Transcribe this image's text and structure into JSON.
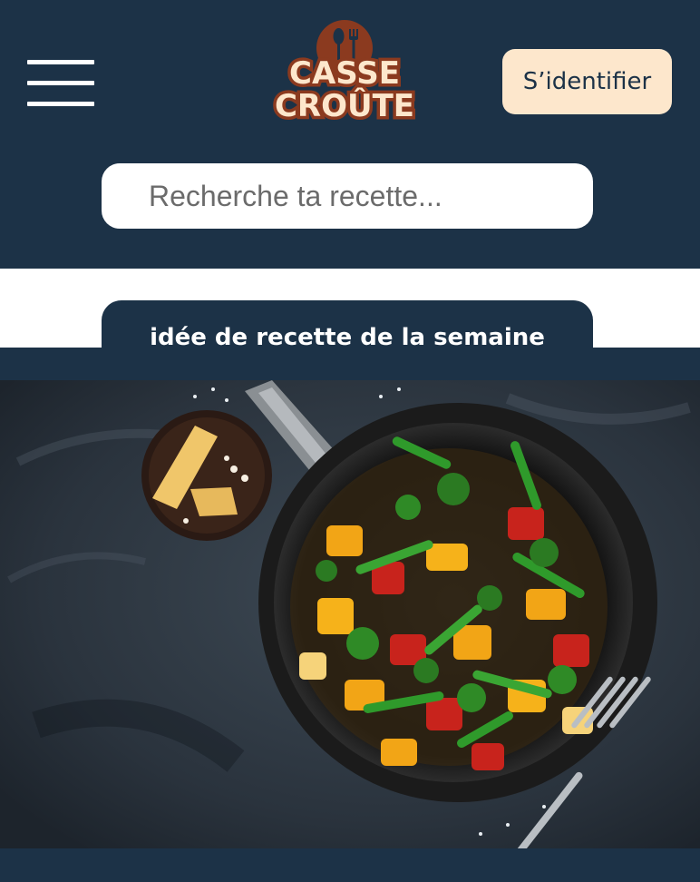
{
  "header": {
    "logo": {
      "line1": "CASSE",
      "line2": "CROÛTE"
    },
    "login_label": "S’identifier"
  },
  "search": {
    "placeholder": "Recherche ta recette..."
  },
  "weekly": {
    "title": "idée de recette de la semaine"
  },
  "colors": {
    "navy": "#1c3247",
    "cream": "#fde7cc",
    "logo_brown": "#8b3a1f"
  },
  "icons": [
    "hamburger-menu-icon",
    "fork-knife-icon"
  ]
}
